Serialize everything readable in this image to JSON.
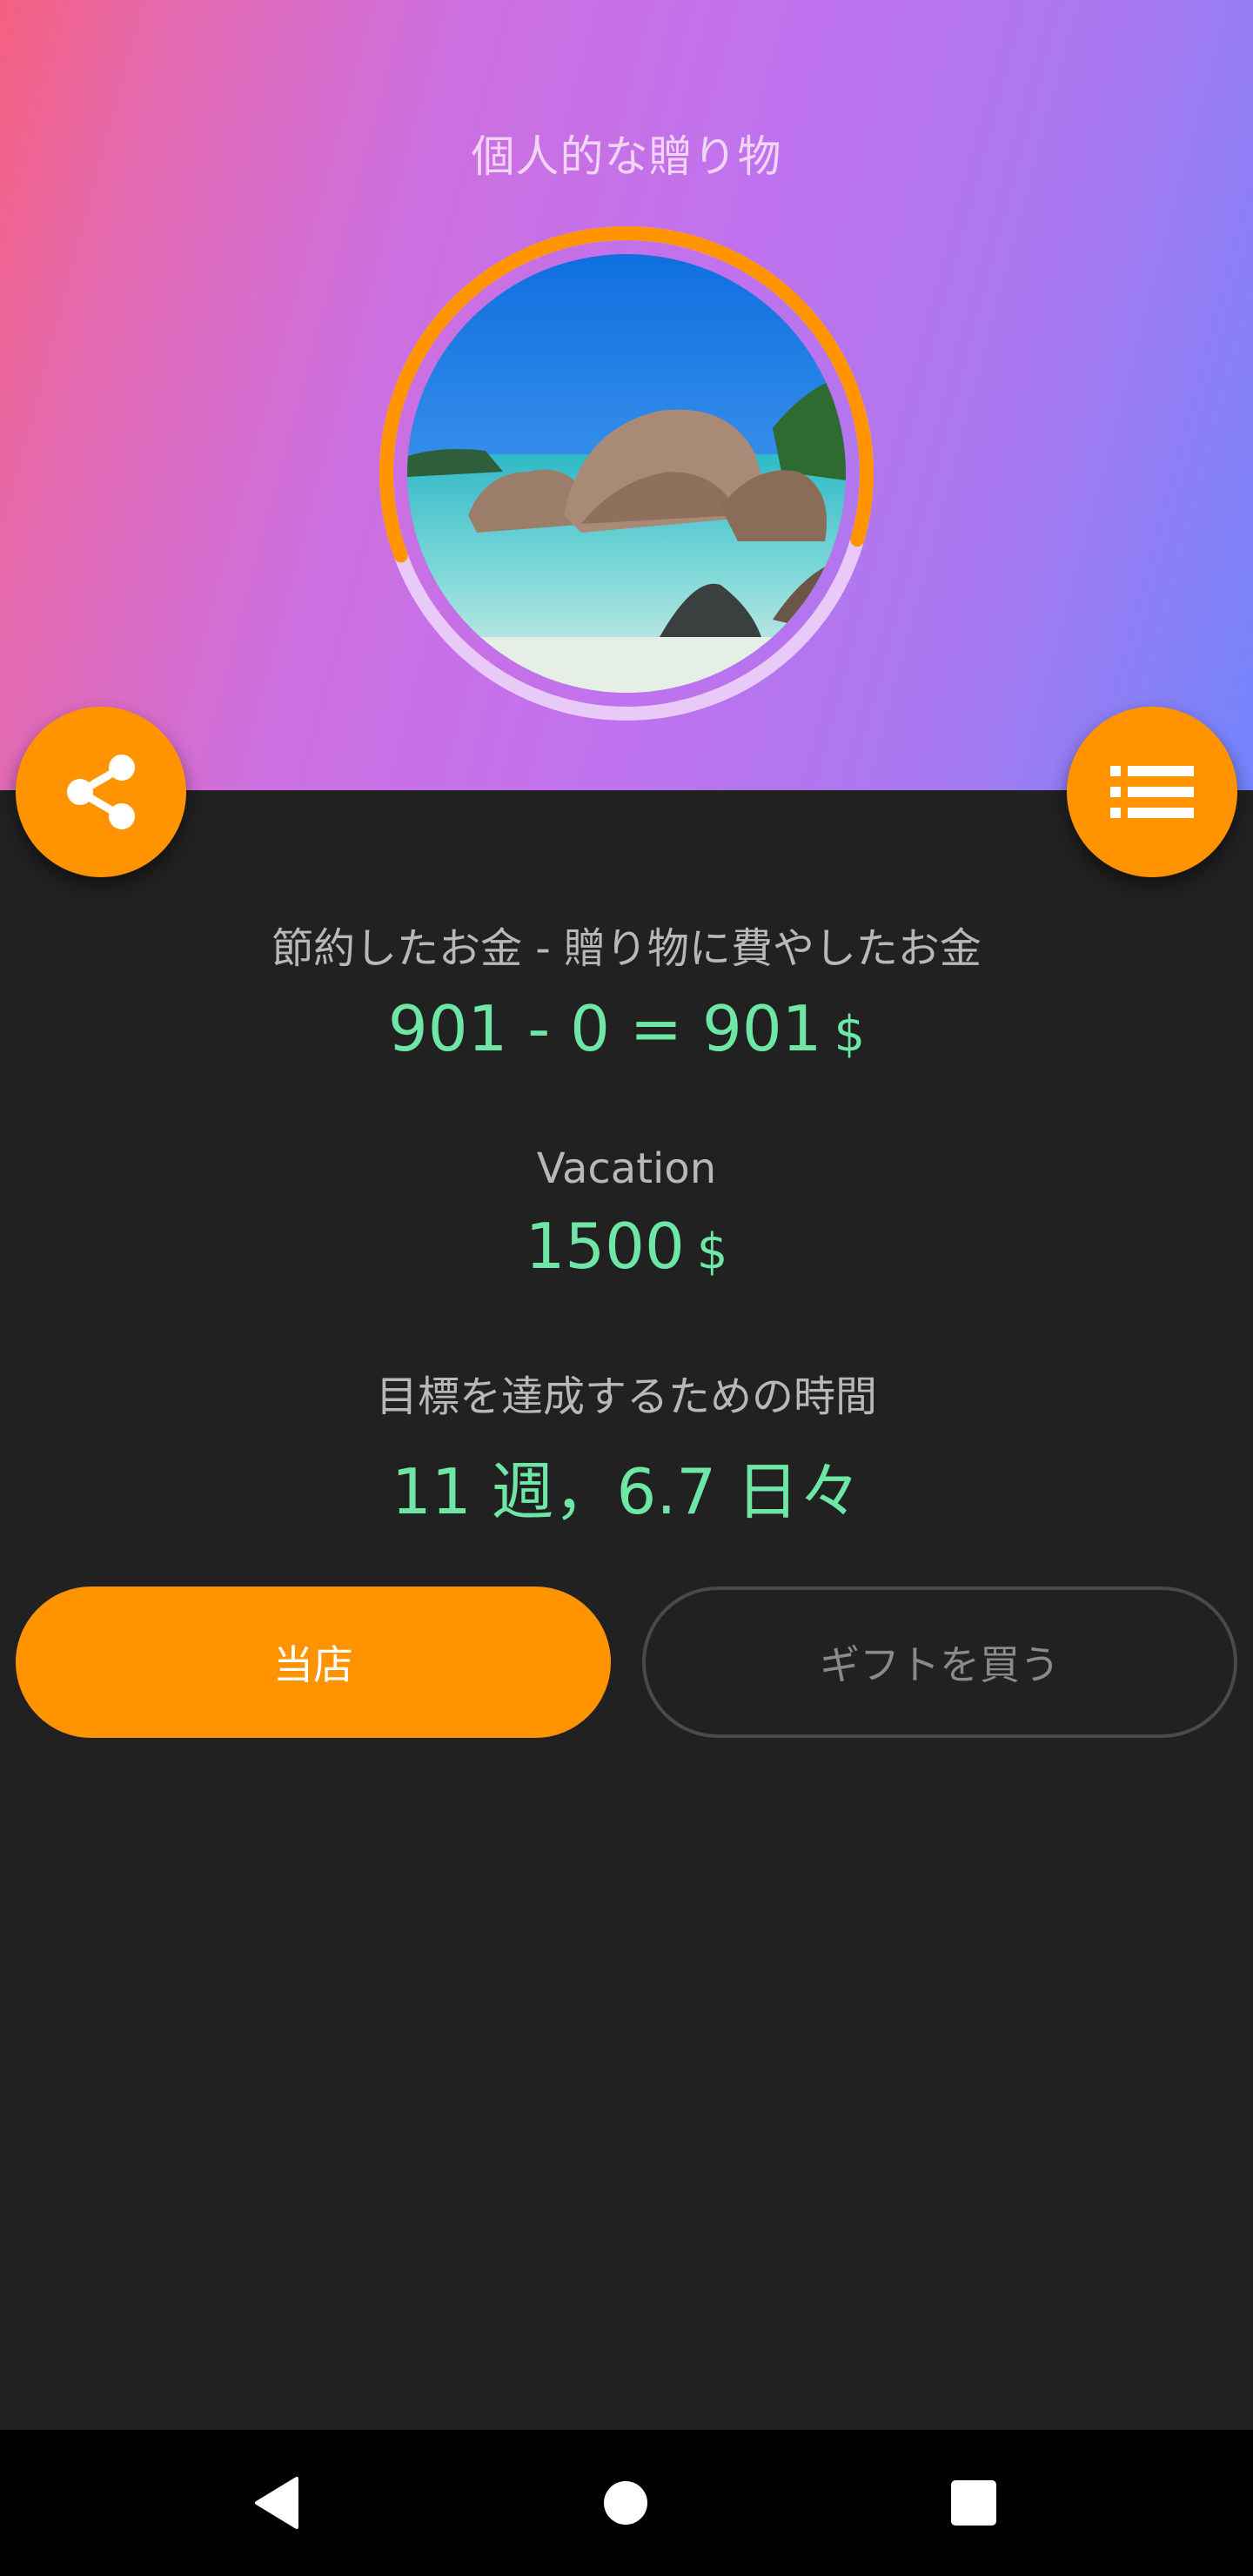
{
  "header": {
    "title": "個人的な贈り物",
    "gradient": [
      "#f4607f",
      "#cc6fe0",
      "#7384fc"
    ]
  },
  "goal_progress": {
    "fraction": 0.6,
    "ring_color": "#ff9400",
    "track_color": "#e9c9f7",
    "image": "beach-photo"
  },
  "fabs": {
    "share_icon": "share-icon",
    "list_icon": "list-icon",
    "color": "#ff9400"
  },
  "savings": {
    "label": "節約したお金 - 贈り物に費やしたお金",
    "expression": "901 - 0 = 901",
    "currency": "$"
  },
  "goal": {
    "label": "Vacation",
    "amount": "1500",
    "currency": "$"
  },
  "time": {
    "label": "目標を達成するための時間",
    "value": "11 週，6.7 日々"
  },
  "buttons": {
    "shop": "当店",
    "buy_gift": "ギフトを買う"
  },
  "nav": {
    "back": "back-icon",
    "home": "home-icon",
    "recents": "recents-icon"
  },
  "colors": {
    "accent": "#ff9400",
    "value_text": "#6ee6a6",
    "background": "#212121"
  }
}
